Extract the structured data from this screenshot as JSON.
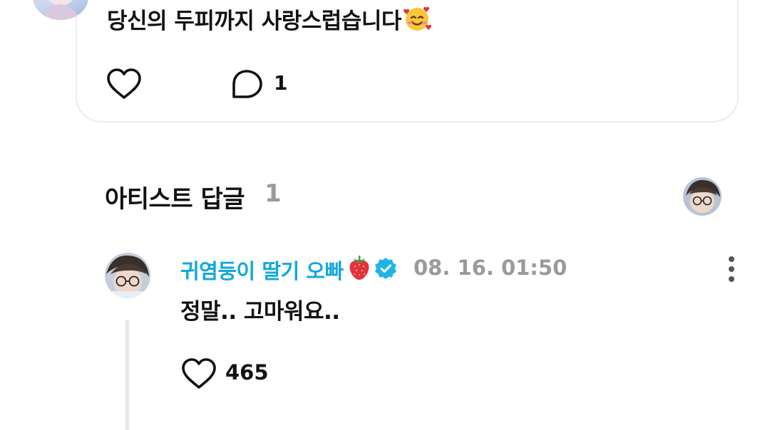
{
  "post": {
    "text": "당신의 두피까지 사랑스럽습니다",
    "emoji_icon": "smiling-face-with-hearts-icon",
    "like_icon": "heart-outline-icon",
    "comment_icon": "speech-bubble-icon",
    "comment_count": "1"
  },
  "artist_replies": {
    "title": "아티스트 답글",
    "count": "1"
  },
  "reply": {
    "author": "귀염둥이 딸기 오빠",
    "author_emoji": "strawberry-icon",
    "badge_icon": "verified-badge-icon",
    "timestamp": "08. 16. 01:50",
    "text": "정말.. 고마워요..",
    "like_count": "465",
    "more_icon": "vertical-ellipsis-icon"
  },
  "colors": {
    "author_name": "#14a8dd",
    "muted": "#9a9a9a",
    "verified": "#1fb5e6",
    "card_border": "#ececec",
    "thread_line": "#e6e6e6"
  }
}
